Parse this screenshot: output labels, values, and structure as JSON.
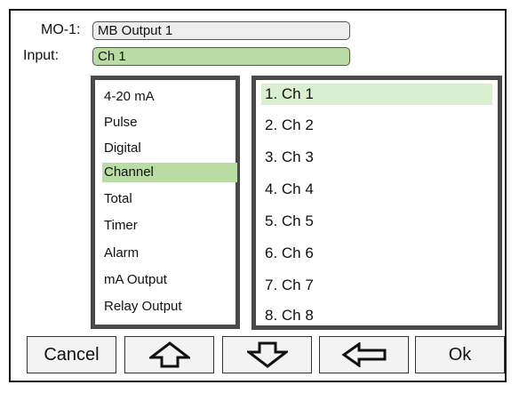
{
  "header": {
    "mo_label": "MO-1:",
    "mo_value": "MB Output 1",
    "input_label": "Input:",
    "input_value": "Ch 1"
  },
  "type_list": {
    "items": [
      "4-20 mA",
      "Pulse",
      "Digital",
      "Channel",
      "Total",
      "Timer",
      "Alarm",
      "mA Output",
      "Relay Output"
    ],
    "selected_index": 3
  },
  "channel_list": {
    "items": [
      "1. Ch 1",
      "2. Ch 2",
      "3. Ch 3",
      "4. Ch 4",
      "5. Ch 5",
      "6. Ch 6",
      "7. Ch 7",
      "8. Ch 8"
    ],
    "selected_index": 0
  },
  "buttons": {
    "cancel_label": "Cancel",
    "up_icon": "up-arrow-icon",
    "down_icon": "down-arrow-icon",
    "back_icon": "left-arrow-icon",
    "ok_label": "Ok"
  },
  "colors": {
    "selected_green": "#b8dca4",
    "selected_light_green": "#daeed0",
    "field_gray": "#ededed"
  }
}
